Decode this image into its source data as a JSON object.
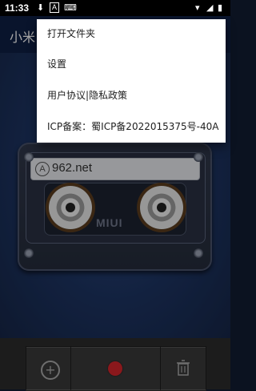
{
  "status": {
    "time": "11:33",
    "icons": [
      "download-icon",
      "a-box-icon",
      "keyboard-icon",
      "wifi-icon",
      "signal-icon",
      "battery-icon"
    ]
  },
  "app": {
    "title": "小米"
  },
  "menu": {
    "items": [
      {
        "label": "打开文件夹"
      },
      {
        "label": "设置"
      },
      {
        "label": "用户协议|隐私政策"
      },
      {
        "label": "ICP备案：蜀ICP备2022015375号-40A"
      }
    ]
  },
  "cassette": {
    "label_text": "962.net",
    "brand": "MIUI"
  },
  "controls": {
    "add": "add-icon",
    "record": "record-icon",
    "delete": "trash-icon"
  },
  "colors": {
    "accent": "#d4252b",
    "app_bar": "#0f1f44"
  }
}
